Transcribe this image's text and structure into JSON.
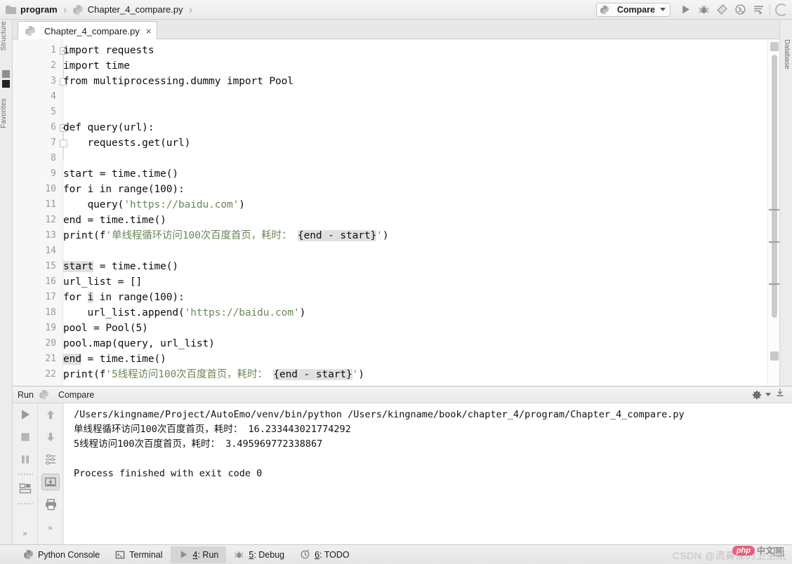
{
  "breadcrumb": {
    "folder_icon": "folder-icon",
    "project": "program",
    "separator": "›",
    "file_icon": "python-file-icon",
    "file": "Chapter_4_compare.py"
  },
  "toolbar": {
    "run_config": {
      "icon": "python-icon",
      "label": "Compare",
      "dropdown_icon": "chevron-down-icon"
    },
    "buttons": [
      {
        "name": "run-button",
        "icon": "play-icon"
      },
      {
        "name": "debug-button",
        "icon": "bug-icon"
      },
      {
        "name": "coverage-button",
        "icon": "coverage-icon"
      },
      {
        "name": "profile-button",
        "icon": "profile-icon"
      },
      {
        "name": "attach-button",
        "icon": "attach-lines-icon"
      },
      {
        "name": "search-everywhere-button",
        "icon": "search-circle-icon"
      }
    ]
  },
  "editor_tab": {
    "icon": "python-file-icon",
    "label": "Chapter_4_compare.py",
    "close_icon": "×"
  },
  "left_tool_strip": [
    {
      "label": "Structure"
    },
    {
      "label": "Favorites"
    }
  ],
  "right_tool_strip": [
    {
      "label": "Database"
    }
  ],
  "editor": {
    "first_line": 1,
    "lines": [
      {
        "n": 1,
        "tokens": [
          {
            "t": "import requests"
          }
        ]
      },
      {
        "n": 2,
        "tokens": [
          {
            "t": "import time"
          }
        ]
      },
      {
        "n": 3,
        "tokens": [
          {
            "t": "from multiprocessing.dummy import Pool"
          }
        ]
      },
      {
        "n": 4,
        "tokens": []
      },
      {
        "n": 5,
        "tokens": []
      },
      {
        "n": 6,
        "tokens": [
          {
            "t": "def query(url):"
          }
        ]
      },
      {
        "n": 7,
        "tokens": [
          {
            "t": "    requests.get(url)"
          }
        ]
      },
      {
        "n": 8,
        "tokens": []
      },
      {
        "n": 9,
        "tokens": [
          {
            "t": "start = time.time()"
          }
        ]
      },
      {
        "n": 10,
        "tokens": [
          {
            "t": "for i in range(100):"
          }
        ]
      },
      {
        "n": 11,
        "tokens": [
          {
            "t": "    query("
          },
          {
            "t": "'https://baidu.com'",
            "c": "str"
          },
          {
            "t": ")"
          }
        ]
      },
      {
        "n": 12,
        "tokens": [
          {
            "t": "end = time.time()"
          }
        ]
      },
      {
        "n": 13,
        "tokens": [
          {
            "t": "print(f"
          },
          {
            "t": "'单线程循环访问100次百度首页，耗时： ",
            "c": "str"
          },
          {
            "t": "{end - start}",
            "c": "hl"
          },
          {
            "t": "'",
            "c": "str"
          },
          {
            "t": ")"
          }
        ]
      },
      {
        "n": 14,
        "tokens": []
      },
      {
        "n": 15,
        "tokens": [
          {
            "t": "start",
            "c": "hl"
          },
          {
            "t": " = time.time()"
          }
        ]
      },
      {
        "n": 16,
        "tokens": [
          {
            "t": "url_list = []"
          }
        ]
      },
      {
        "n": 17,
        "tokens": [
          {
            "t": "for "
          },
          {
            "t": "i",
            "c": "hl"
          },
          {
            "t": " in range(100):"
          }
        ]
      },
      {
        "n": 18,
        "tokens": [
          {
            "t": "    url_list.append("
          },
          {
            "t": "'https://baidu.com'",
            "c": "str"
          },
          {
            "t": ")"
          }
        ]
      },
      {
        "n": 19,
        "tokens": [
          {
            "t": "pool = Pool(5)"
          }
        ]
      },
      {
        "n": 20,
        "tokens": [
          {
            "t": "pool.map(query, url_list)"
          }
        ]
      },
      {
        "n": 21,
        "tokens": [
          {
            "t": "end",
            "c": "hl"
          },
          {
            "t": " = time.time()"
          }
        ]
      },
      {
        "n": 22,
        "tokens": [
          {
            "t": "print(f"
          },
          {
            "t": "'5线程访问100次百度首页，耗时： ",
            "c": "str"
          },
          {
            "t": "{end - start}",
            "c": "hl"
          },
          {
            "t": "'",
            "c": "str"
          },
          {
            "t": ")"
          }
        ]
      }
    ]
  },
  "run_panel": {
    "title": "Run",
    "config_icon": "python-icon",
    "config_name": "Compare",
    "settings_icon": "gear-icon",
    "settings_dropdown_icon": "chevron-down-icon",
    "export_icon": "download-icon",
    "left_toolbar": [
      {
        "name": "rerun-button",
        "icon": "play-icon"
      },
      {
        "name": "stop-button",
        "icon": "stop-square-icon"
      },
      {
        "name": "pause-button",
        "icon": "pause-icon"
      },
      {
        "name": "restore-layout-button",
        "icon": "layout-icon"
      }
    ],
    "second_toolbar": [
      {
        "name": "scroll-up-button",
        "icon": "arrow-up-icon"
      },
      {
        "name": "scroll-down-button",
        "icon": "arrow-down-icon"
      },
      {
        "name": "soft-wrap-button",
        "icon": "soft-wrap-icon"
      },
      {
        "name": "scroll-to-end-button",
        "icon": "scroll-end-icon"
      },
      {
        "name": "print-button",
        "icon": "printer-icon"
      }
    ],
    "expand_icon": "»",
    "console_lines": [
      "/Users/kingname/Project/AutoEmo/venv/bin/python /Users/kingname/book/chapter_4/program/Chapter_4_compare.py",
      "单线程循环访问100次百度首页，耗时： 16.233443021774292",
      "5线程访问100次百度首页，耗时： 3.495969772338867",
      "",
      "Process finished with exit code 0"
    ]
  },
  "status_bar": [
    {
      "name": "python-console",
      "icon": "python-icon",
      "key": "",
      "label": "Python Console",
      "active": false
    },
    {
      "name": "terminal",
      "icon": "terminal-icon",
      "key": "",
      "label": "Terminal",
      "active": false
    },
    {
      "name": "run",
      "icon": "play-icon",
      "key": "4",
      "label": ": Run",
      "active": true
    },
    {
      "name": "debug",
      "icon": "bug-icon",
      "key": "5",
      "label": ": Debug",
      "active": false
    },
    {
      "name": "todo",
      "icon": "todo-icon",
      "key": "6",
      "label": ": TODO",
      "active": false
    }
  ],
  "watermark": {
    "text": "CSDN @流鼻涕的卫生纸",
    "badge_php": "php",
    "badge_cn": "中文",
    "badge_cn_box": "网"
  },
  "colors": {
    "editor_bg": "#ffffff",
    "panel_bg": "#f0f0f0",
    "string_token": "#6a8759",
    "selection_highlight": "#e0e0e0",
    "gutter_text": "#9a9a9a"
  }
}
